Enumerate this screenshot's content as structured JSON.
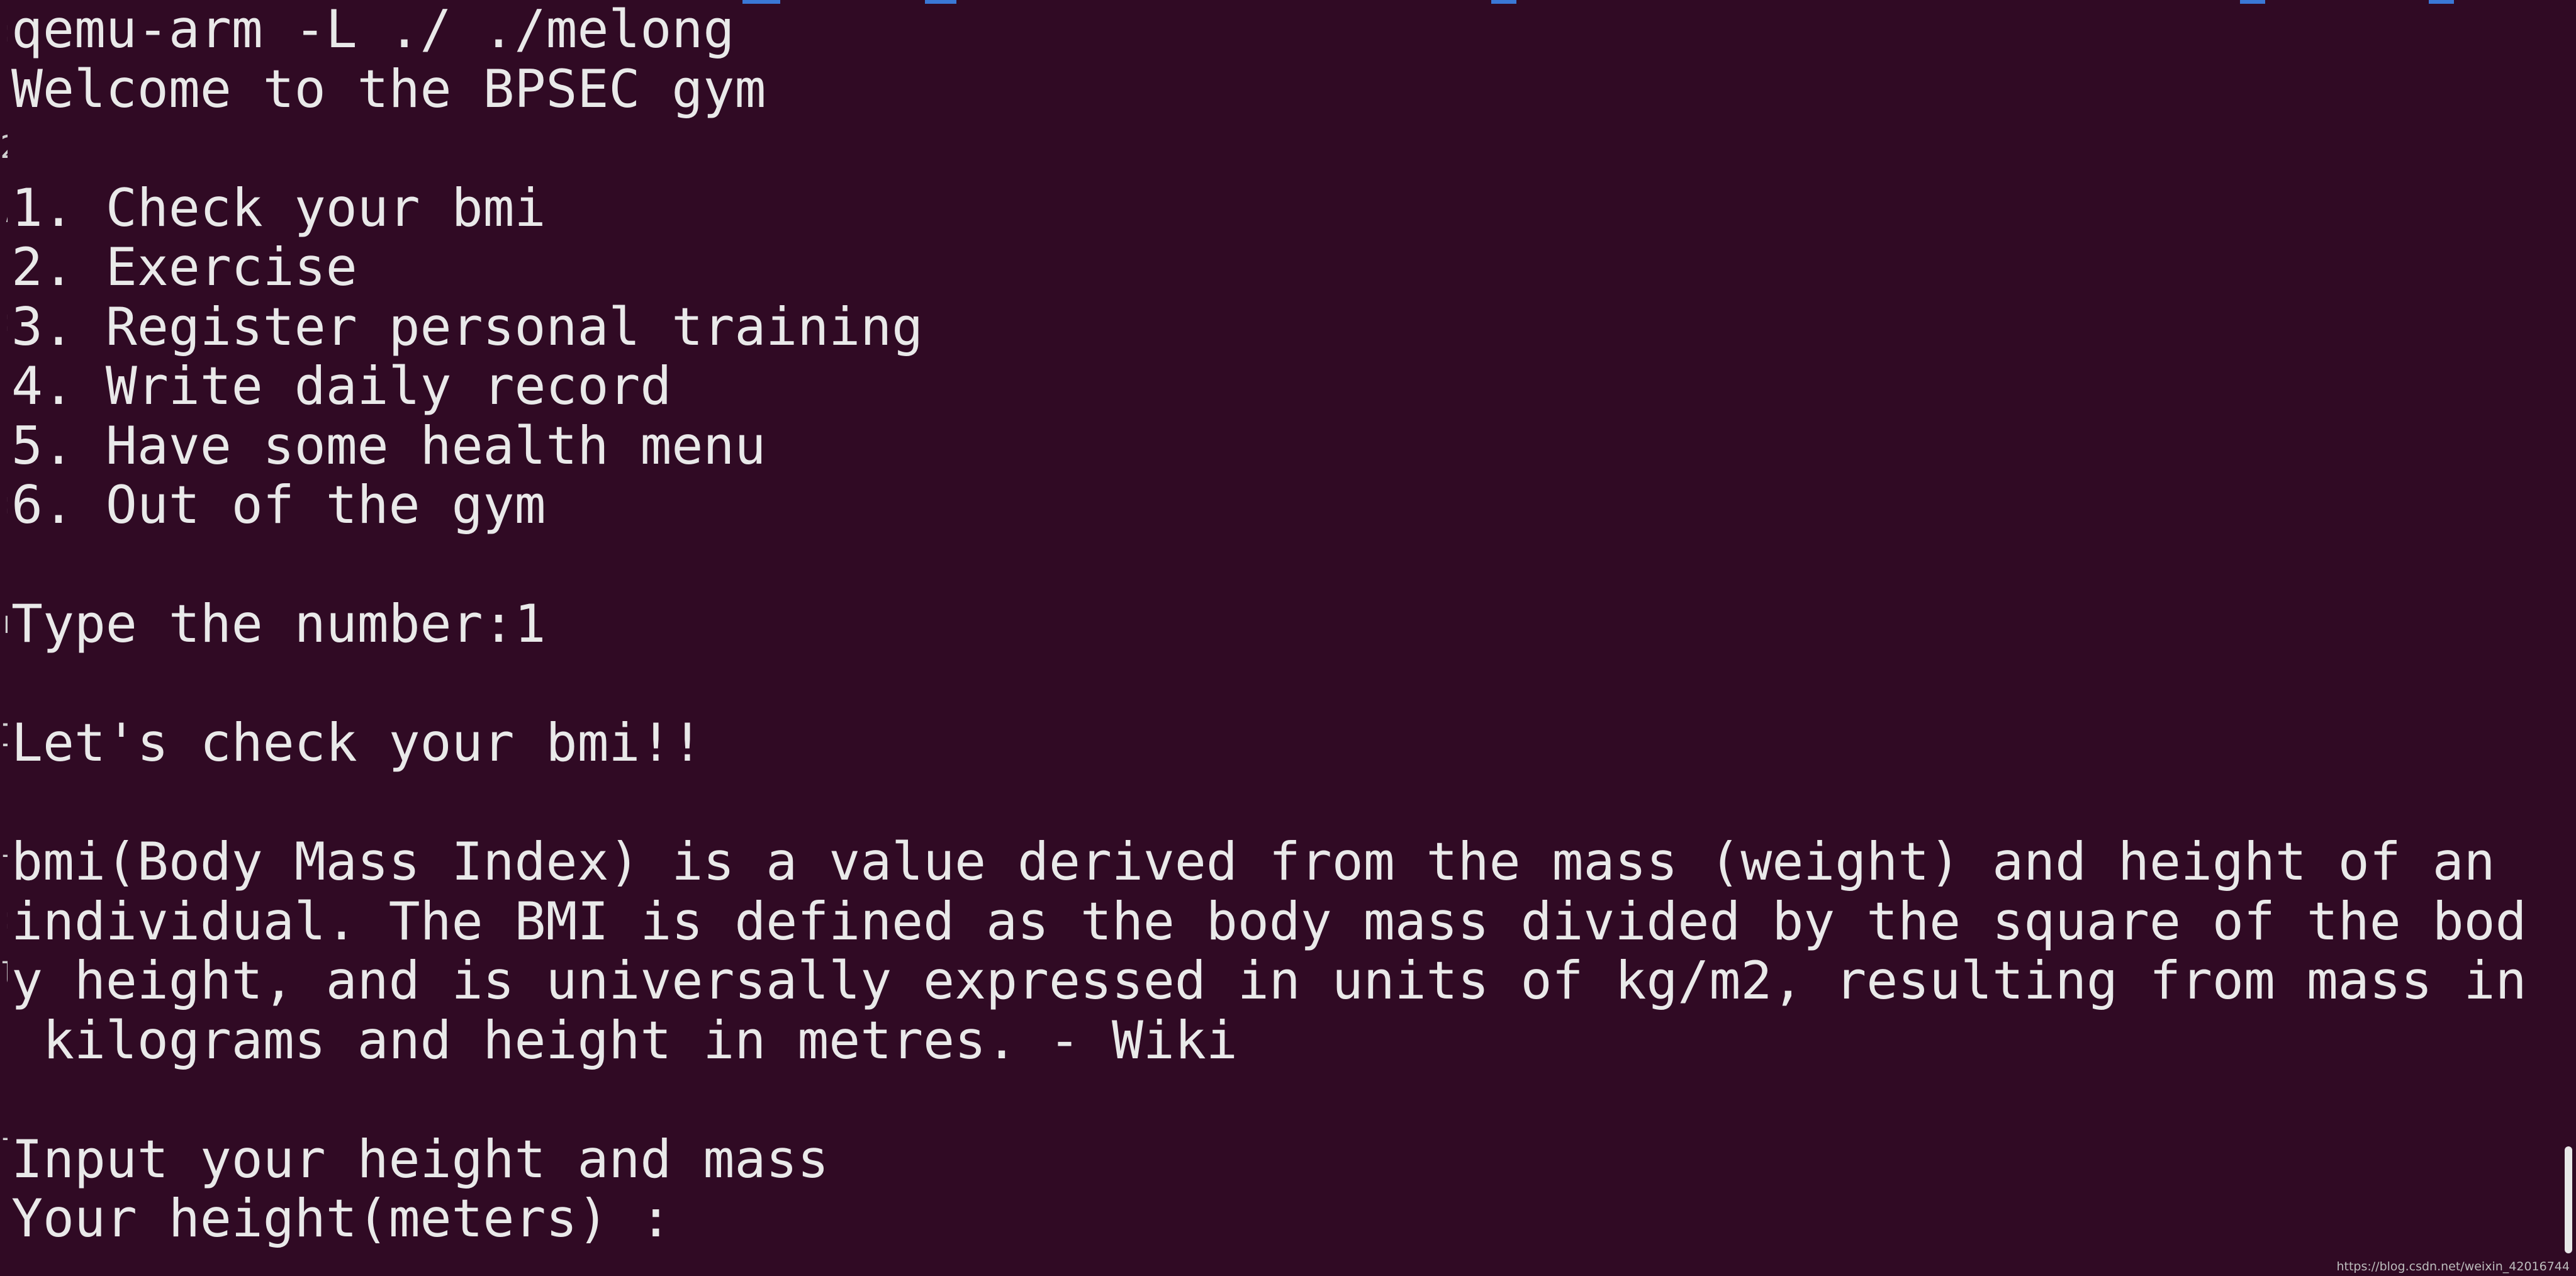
{
  "terminal": {
    "lines": [
      "qemu-arm -L ./ ./melong",
      "Welcome to the BPSEC gym",
      "",
      "1. Check your bmi",
      "2. Exercise",
      "3. Register personal training",
      "4. Write daily record",
      "5. Have some health menu",
      "6. Out of the gym",
      "",
      "Type the number:1",
      "",
      "Let's check your bmi!!",
      "",
      "bmi(Body Mass Index) is a value derived from the mass (weight) and height of an",
      "individual. The BMI is defined as the body mass divided by the square of the bod",
      "y height, and is universally expressed in units of kg/m2, resulting from mass in",
      " kilograms and height in metres. - Wiki",
      "",
      "Input your height and mass",
      "Your height(meters) : "
    ]
  },
  "watermark": "https://blog.csdn.net/weixin_42016744",
  "colors": {
    "background": "#300a24",
    "foreground": "#e9e9e9"
  }
}
